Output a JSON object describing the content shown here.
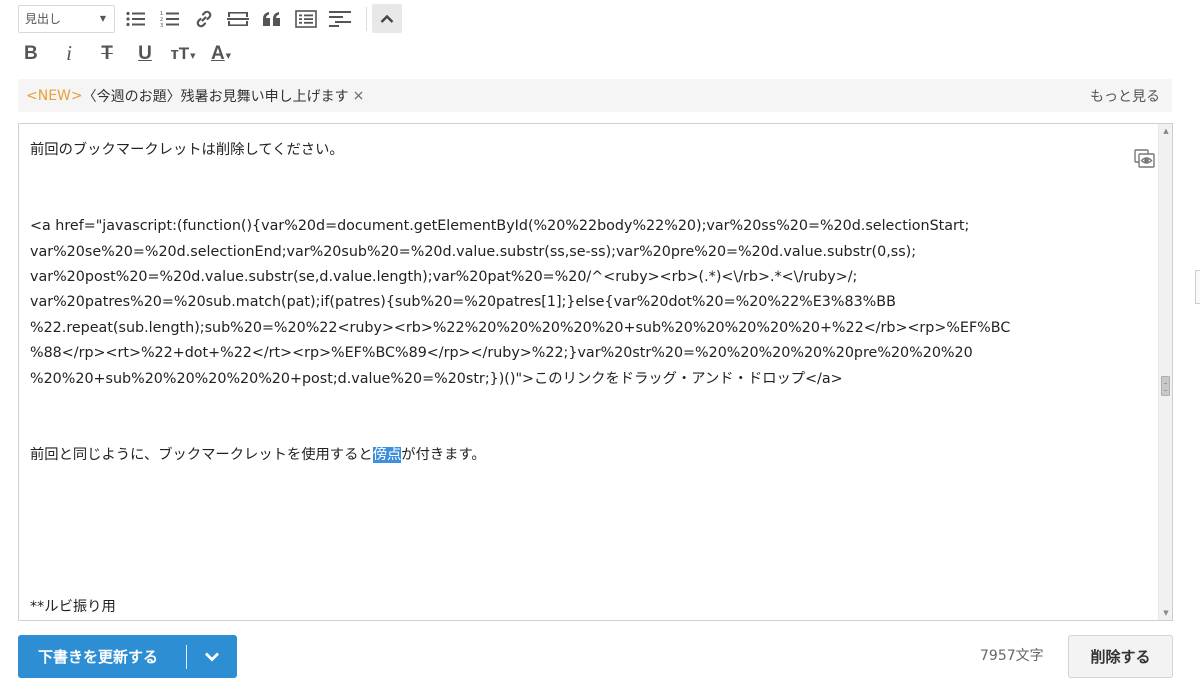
{
  "toolbar": {
    "heading_select": "見出し",
    "icons": [
      "unordered-list-icon",
      "ordered-list-icon",
      "link-icon",
      "horizontal-rule-icon",
      "quote-icon",
      "table-of-contents-icon",
      "more-insert-icon",
      "collapse-toolbar-icon"
    ],
    "format": {
      "bold": "B",
      "italic": "i",
      "strike": "T",
      "underline": "U",
      "text_size": "тT",
      "text_color": "A"
    }
  },
  "topic": {
    "new_tag": "<NEW>",
    "text": "〈今週のお題〉残暑お見舞い申し上げます",
    "close": "×",
    "more": "もっと見る"
  },
  "editor": {
    "line1": "前回のブックマークレットは削除してください。",
    "code_lines": [
      "<a href=\"javascript:(function(){var%20d=document.getElementById(%20%22body%22%20);var%20ss%20=%20d.selectionStart;",
      "var%20se%20=%20d.selectionEnd;var%20sub%20=%20d.value.substr(ss,se-ss);var%20pre%20=%20d.value.substr(0,ss);",
      "var%20post%20=%20d.value.substr(se,d.value.length);var%20pat%20=%20/^<ruby><rb>(.*)<\\/rb>.*<\\/ruby>/;",
      "var%20patres%20=%20sub.match(pat);if(patres){sub%20=%20patres[1];}else{var%20dot%20=%20%22%E3%83%BB",
      "%22.repeat(sub.length);sub%20=%20%22<ruby><rb>%22%20%20%20%20%20+sub%20%20%20%20%20+%22</rb><rp>%EF%BC",
      "%88</rp><rt>%22+dot+%22</rt><rp>%EF%BC%89</rp></ruby>%22;}var%20str%20=%20%20%20%20%20pre%20%20%20",
      "%20%20+sub%20%20%20%20%20+post;d.value%20=%20str;})()\">このリンクをドラッグ・アンド・ドロップ</a>"
    ],
    "line_after_before": "前回と同じように、ブックマークレットを使用すると",
    "line_after_selected": "傍点",
    "line_after_after": "が付きます。",
    "last_line": "**ルビ振り用"
  },
  "footer": {
    "save_label": "下書きを更新する",
    "char_count": "7957文字",
    "delete_label": "削除する"
  },
  "colors": {
    "accent": "#2d8ed3",
    "new_tag": "#e8a03a",
    "selection": "#3f8fdf"
  }
}
